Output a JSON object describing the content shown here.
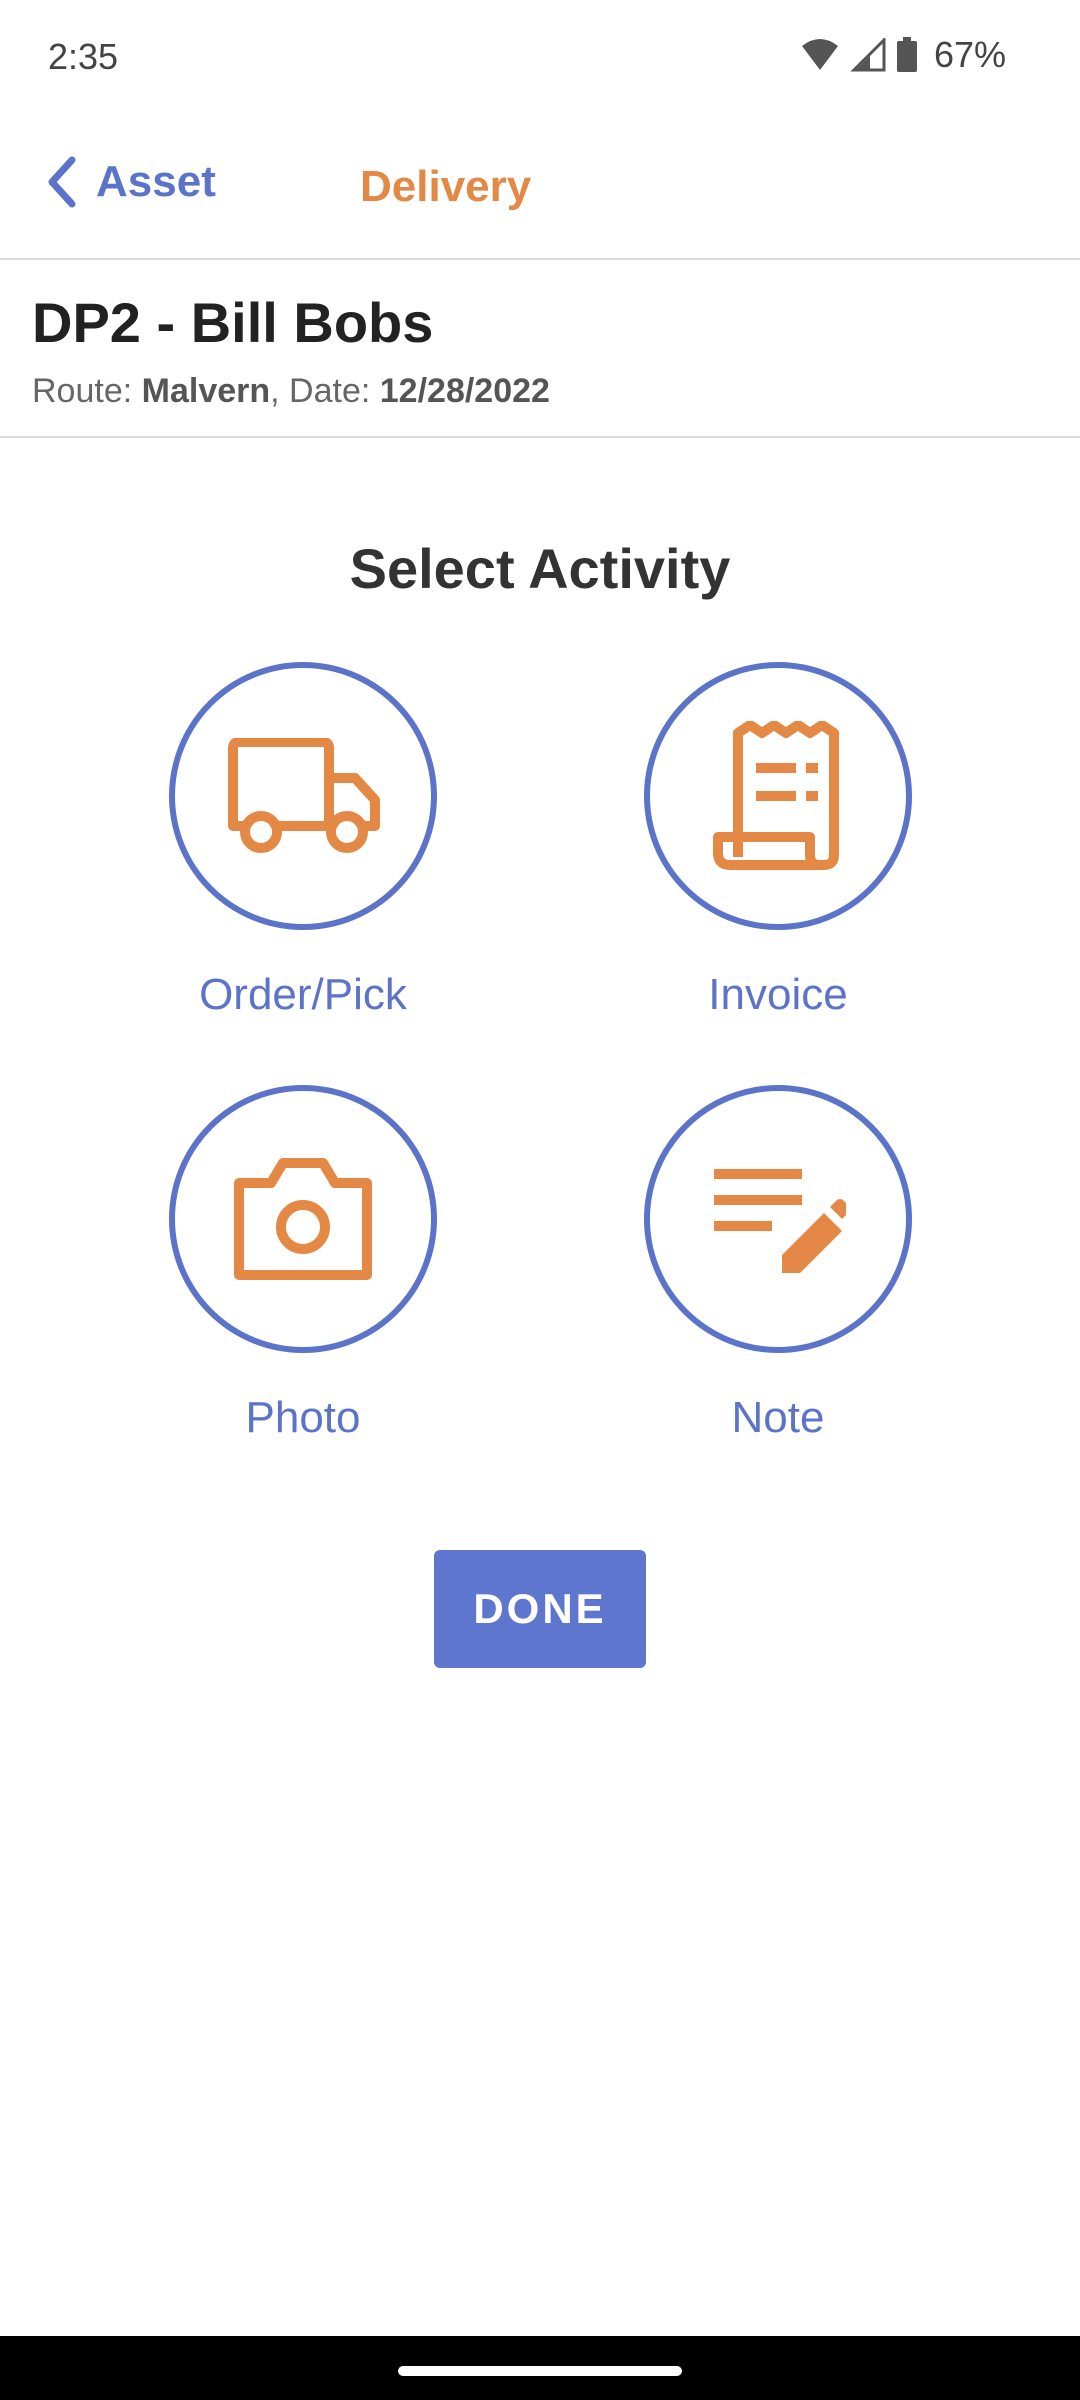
{
  "status_bar": {
    "time": "2:35",
    "battery": "67%"
  },
  "header": {
    "back_label": "Asset",
    "title": "Delivery"
  },
  "customer": {
    "name": "DP2 - Bill Bobs",
    "route_label": "Route:",
    "route_value": "Malvern",
    "date_label": ", Date:",
    "date_value": "12/28/2022"
  },
  "activity": {
    "title": "Select Activity",
    "items": [
      {
        "label": "Order/Pick",
        "icon": "truck-icon"
      },
      {
        "label": "Invoice",
        "icon": "receipt-icon"
      },
      {
        "label": "Photo",
        "icon": "camera-icon"
      },
      {
        "label": "Note",
        "icon": "note-edit-icon"
      }
    ]
  },
  "done_button": {
    "label": "DONE"
  },
  "colors": {
    "accent_blue": "#5b73c9",
    "accent_orange": "#e48845",
    "button_blue": "#5f76cf"
  }
}
